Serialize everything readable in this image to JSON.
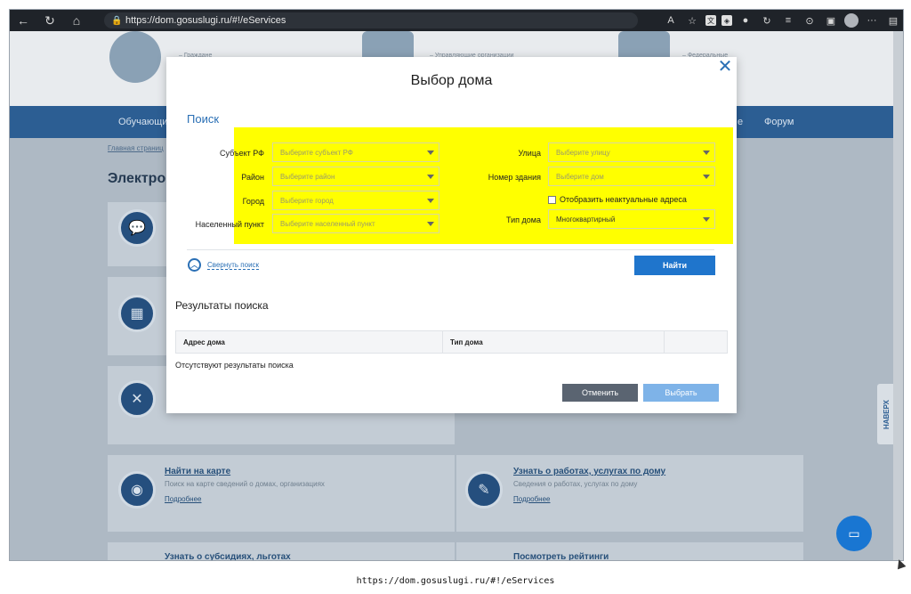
{
  "browser": {
    "url": "https://dom.gosuslugi.ru/#!/eServices"
  },
  "page": {
    "breadcrumb": "Главная страниц",
    "heading": "Электрон",
    "nav_items": [
      "Обучающи",
      "Форум"
    ],
    "nav_partial": "е",
    "top_texts": [
      "– Граждане",
      "– Управляющие организации",
      "– Федеральные"
    ],
    "tiles": [
      {
        "title": "Найти на карте",
        "desc": "Поиск на карте сведений о домах, организациях",
        "more": "Подробнее"
      },
      {
        "title": "Узнать о работах, услугах по дому",
        "desc": "Сведения о работах, услугах по дому",
        "more": "Подробнее"
      },
      {
        "title": "Узнать о субсидиях, льготах",
        "desc": "",
        "more": ""
      },
      {
        "title": "Посмотреть рейтинги",
        "desc": "",
        "more": ""
      }
    ],
    "naverh": "НАВЕРХ"
  },
  "modal": {
    "title": "Выбор дома",
    "search_heading": "Поиск",
    "fields": {
      "subject_label": "Субъект РФ",
      "subject_placeholder": "Выберите субъект РФ",
      "district_label": "Район",
      "district_placeholder": "Выберите район",
      "city_label": "Город",
      "city_placeholder": "Выберите город",
      "locality_label": "Населенный пункт",
      "locality_placeholder": "Выберите населенный пункт",
      "street_label": "Улица",
      "street_placeholder": "Выберите улицу",
      "building_label": "Номер здания",
      "building_placeholder": "Выберите дом",
      "outdated_label": "Отобразить неактуальные адреса",
      "house_type_label": "Тип дома",
      "house_type_value": "Многоквартирный"
    },
    "collapse_label": "Свернуть поиск",
    "find_button": "Найти",
    "results_heading": "Результаты поиска",
    "table_headers": [
      "Адрес дома",
      "Тип дома",
      ""
    ],
    "no_results": "Отсутствуют результаты поиска",
    "cancel_button": "Отменить",
    "select_button": "Выбрать"
  },
  "caption": "https://dom.gosuslugi.ru/#!/eServices",
  "colors": {
    "accent": "#1f75cc",
    "highlight": "#ffff00",
    "nav_bar": "#2c5e93"
  }
}
